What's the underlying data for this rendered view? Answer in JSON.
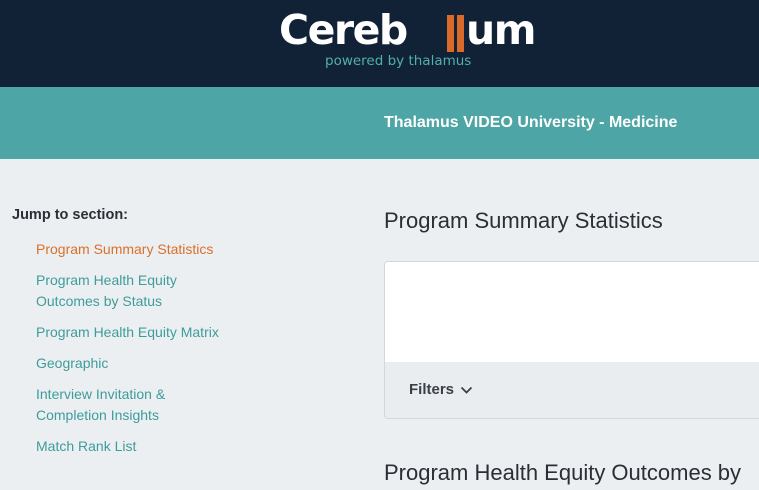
{
  "header": {
    "logo_text": "Cerebellum",
    "logo_left": "Cereb",
    "logo_right": "um",
    "tagline": "powered by thalamus",
    "program_title": "Thalamus VIDEO University - Medicine"
  },
  "sidebar": {
    "jump_label": "Jump to section:",
    "items": [
      {
        "label": "Program Summary Statistics"
      },
      {
        "label": "Program Health Equity Outcomes by Status"
      },
      {
        "label": "Program Health Equity Matrix"
      },
      {
        "label": "Geographic"
      },
      {
        "label": "Interview Invitation & Completion Insights"
      },
      {
        "label": "Match Rank List"
      }
    ]
  },
  "main": {
    "sections": [
      {
        "title": "Program Summary Statistics"
      },
      {
        "title": "Program Health Equity Outcomes by"
      }
    ],
    "filters_label": "Filters",
    "filters_icon": "chevron-down-icon"
  },
  "colors": {
    "topbar": "#122236",
    "subheader": "#4ea5a5",
    "accent_orange": "#d9702a",
    "link_teal": "#3e9c9a",
    "background": "#eceff2"
  }
}
